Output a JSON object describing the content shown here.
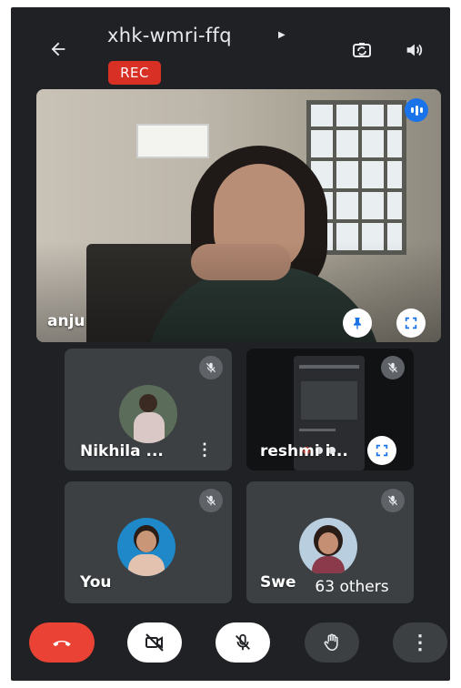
{
  "header": {
    "title": "xhk-wmri-ffq",
    "rec_badge": "REC",
    "icons": {
      "back": "back-arrow-icon",
      "switch_camera": "switch-camera-icon",
      "speaker": "speaker-icon",
      "title_caret": "caret-right-icon"
    }
  },
  "main_tile": {
    "name": "anju",
    "icons": {
      "speaking": "speaking-indicator-icon",
      "pin": "pin-icon",
      "fullscreen": "fullscreen-icon"
    }
  },
  "tiles": [
    {
      "name": "Nikhila ...",
      "muted": true,
      "menu_icon": "more-vert-icon"
    },
    {
      "name": "reshmi i...",
      "muted": true,
      "screen_share": true,
      "fullscreen_icon": "fullscreen-icon"
    },
    {
      "name": "You",
      "muted": true
    },
    {
      "name": "Swe",
      "muted": true
    }
  ],
  "others_badge": "63 others",
  "controls": {
    "end_call": "end-call-icon",
    "camera": "camera-off-icon",
    "mic": "mic-off-icon",
    "raise_hand": "raise-hand-icon",
    "more": "more-vert-icon"
  },
  "colors": {
    "background": "#202124",
    "tile": "#3c4043",
    "rec": "#d93025",
    "end_call": "#ea4335",
    "accent": "#1a73e8"
  }
}
